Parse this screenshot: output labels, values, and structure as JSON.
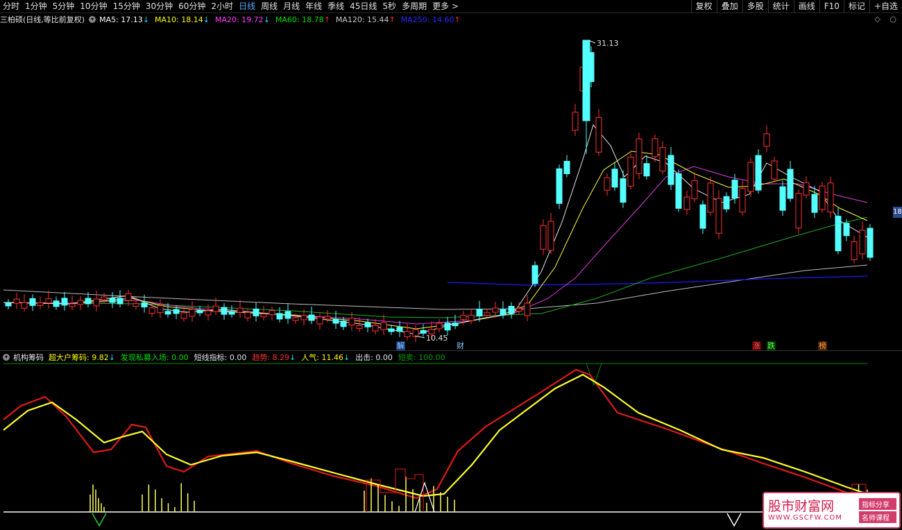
{
  "toolbar": {
    "periods": [
      "分时",
      "1分钟",
      "5分钟",
      "10分钟",
      "15分钟",
      "30分钟",
      "60分钟",
      "2小时",
      "日线",
      "周线",
      "月线",
      "年线",
      "季线",
      "45日线",
      "5秒",
      "多周期",
      "更多 >"
    ],
    "active_period": "日线",
    "tools": [
      "复权",
      "叠加",
      "多股",
      "统计",
      "画线",
      "F10",
      "标记",
      "+自选"
    ]
  },
  "main_header": {
    "stock": "三柏硕",
    "mode": "(日线,等比前复权)",
    "ma": [
      {
        "label": "MA5: 17.13",
        "arrow": "↓",
        "color": "#ffffff"
      },
      {
        "label": "MA10: 18.14",
        "arrow": "↓",
        "color": "#ffff00"
      },
      {
        "label": "MA20: 19.72",
        "arrow": "↓",
        "color": "#ff3cff"
      },
      {
        "label": "MA60: 18.78",
        "arrow": "↑",
        "color": "#00e000"
      },
      {
        "label": "MA120: 15.44",
        "arrow": "↑",
        "color": "#c8c8c8"
      },
      {
        "label": "MA250: 14.60",
        "arrow": "↑",
        "color": "#2a2aff"
      }
    ],
    "corner_icons": [
      "diamond-icon",
      "circle-icon"
    ]
  },
  "price_labels": {
    "high": "31.13",
    "low": "10.45",
    "right_tag": "18"
  },
  "events": [
    {
      "text": "解",
      "color": "#8ac8ff",
      "bg": "#1b3a7a"
    },
    {
      "text": "财",
      "color": "#8ac8ff",
      "bg": "#000000"
    },
    {
      "text": "涨",
      "color": "#ff6060",
      "bg": "#5a0000"
    },
    {
      "text": "跌",
      "color": "#60ff60",
      "bg": "#003a00"
    },
    {
      "text": "榜",
      "color": "#ffa040",
      "bg": "#4a2000"
    }
  ],
  "indicator": {
    "name": "机构筹码",
    "values": [
      {
        "label": "超大户筹码: 9.82",
        "arrow": "↓",
        "color": "#ffff00"
      },
      {
        "label": "发现私募入场: 0.00",
        "arrow": "",
        "color": "#00e000"
      },
      {
        "label": "短线指标: 0.00",
        "arrow": "",
        "color": "#e8e8e8"
      },
      {
        "label": "趋势: 8.29",
        "arrow": "↓",
        "color": "#ff3030"
      },
      {
        "label": "人气: 11.46",
        "arrow": "↓",
        "color": "#ffff00"
      },
      {
        "label": "出击: 0.00",
        "arrow": "",
        "color": "#e8e8e8"
      },
      {
        "label": "短卖: 100.00",
        "arrow": "",
        "color": "#00a000"
      }
    ]
  },
  "watermark": {
    "title": "股市财富网",
    "url": "WWW.GSCFW.COM",
    "tags": [
      "指标分享",
      "名师课程"
    ]
  },
  "colors": {
    "up_candle": "#ff3232",
    "down_candle": "#54ffff",
    "background": "#000000"
  }
}
